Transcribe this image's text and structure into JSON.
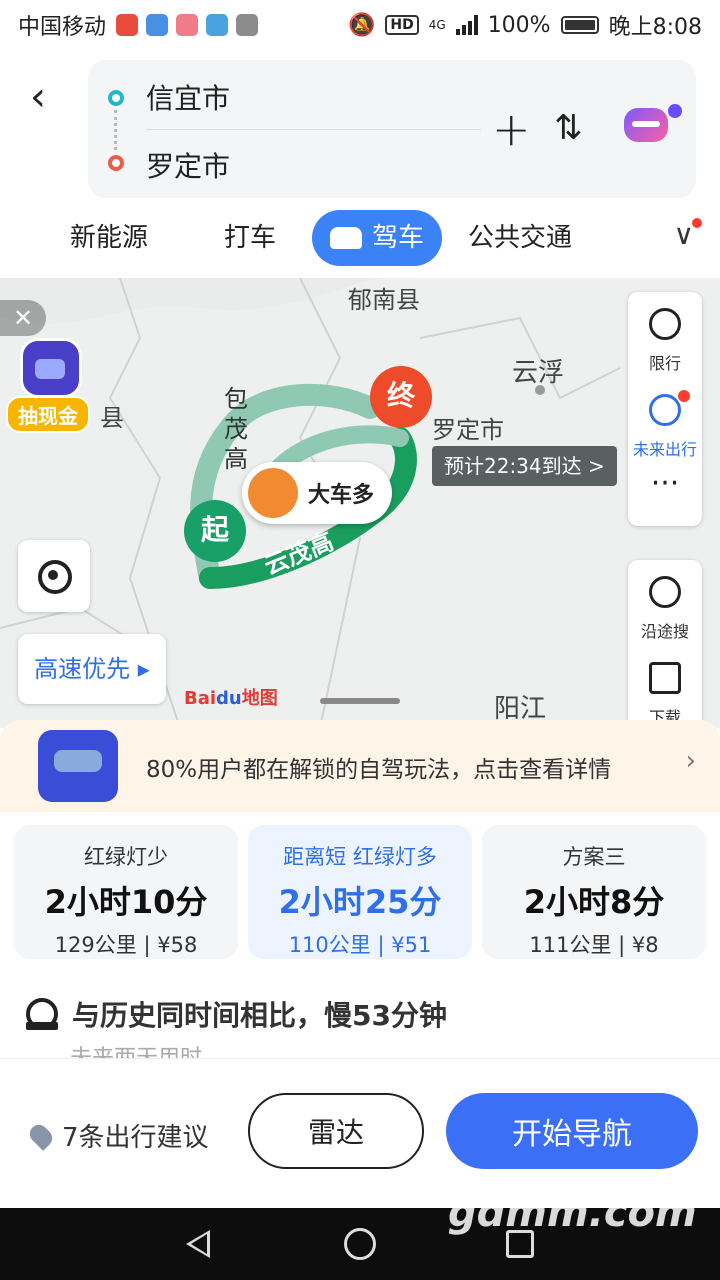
{
  "status_bar": {
    "carrier": "中国移动",
    "network": "4G",
    "battery": "100%",
    "time": "晚上8:08",
    "hd": "HD"
  },
  "route": {
    "start": "信宜市",
    "end": "罗定市",
    "add_icon": "plus-icon",
    "swap_icon": "swap-icon"
  },
  "tabs": [
    {
      "label": "新能源"
    },
    {
      "label": "打车"
    },
    {
      "label": "驾车",
      "active": true
    },
    {
      "label": "公共交通"
    }
  ],
  "map": {
    "places": {
      "yunan": "郁南县",
      "yunfu": "云浮",
      "luoding": "罗定市",
      "yangjiang": "阳江",
      "county": "县"
    },
    "roads": {
      "baomao": "包茂高",
      "yunmao": "云茂高"
    },
    "start_marker": "起",
    "end_marker": "终",
    "truck_label": "大车多",
    "eta": "预计22:34到达 >",
    "cash_label": "抽现金",
    "highway_pref": "高速优先 ▸",
    "logo_text": "Bai",
    "logo_blue": "du",
    "logo_suffix": "地图",
    "side_buttons": {
      "limit": "限行",
      "future": "未来出行",
      "more": "···",
      "search_along": "沿途搜",
      "download": "下载"
    }
  },
  "promo": {
    "text": "80%用户都在解锁的自驾玩法，点击查看详情"
  },
  "plans": [
    {
      "tag": "红绿灯少",
      "time": "2小时10分",
      "distance": "129公里",
      "toll": "¥58"
    },
    {
      "tag": "距离短  红绿灯多",
      "time": "2小时25分",
      "distance": "110公里",
      "toll": "¥51",
      "selected": true
    },
    {
      "tag": "方案三",
      "time": "2小时8分",
      "distance": "111公里",
      "toll": "¥8"
    }
  ],
  "history": {
    "text": "与历史同时间相比，慢53分钟",
    "sub": "未来两天用时"
  },
  "bottom": {
    "advice": "7条出行建议",
    "radar": "雷达",
    "navigate": "开始导航"
  },
  "watermark": "gdmm.com",
  "colors": {
    "accent": "#3b82f6",
    "route_green": "#1a9e5f",
    "start_green": "#18a068",
    "end_red": "#ee4b2b"
  }
}
